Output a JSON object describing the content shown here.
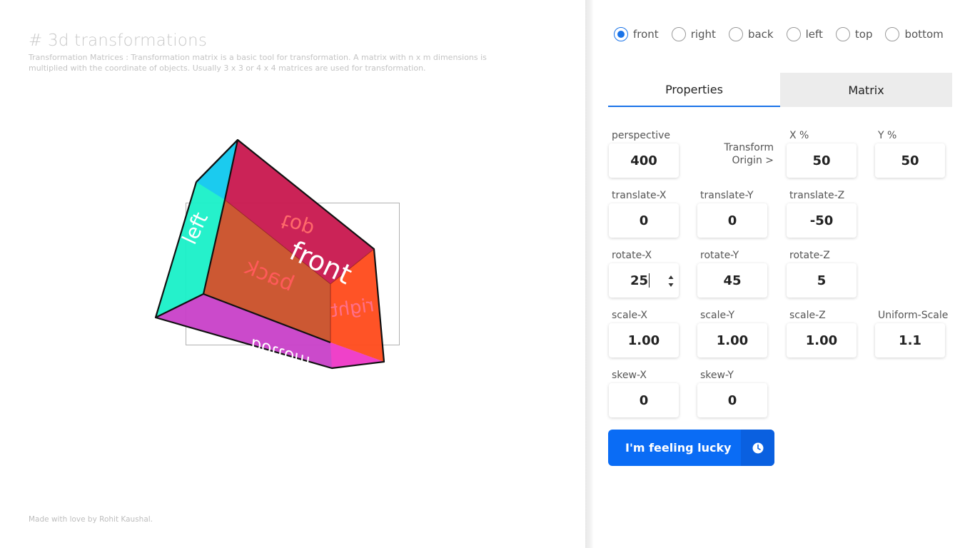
{
  "page": {
    "title": "# 3d transformations",
    "description": "Transformation Matrices : Transformation matrix is a basic tool for transformation. A matrix with n x m dimensions is multiplied with the coordinate of objects. Usually 3 x 3 or 4 x 4 matrices are used for transformation.",
    "footer": "Made with love by Rohit Kaushal."
  },
  "cube": {
    "faces": {
      "front": "front",
      "back": "back",
      "left": "left",
      "right": "right",
      "top": "top",
      "bottom": "bottom"
    },
    "colors": {
      "top": "#c8174e",
      "back": "#c84a22",
      "left": "#19f0c8",
      "left_top": "#1ac8f0",
      "right": "#ff4a1a",
      "bottom": "#c840c8",
      "bottom_right": "#f040c8"
    }
  },
  "faceSelector": {
    "selected": "front",
    "options": [
      "front",
      "right",
      "back",
      "left",
      "top",
      "bottom"
    ]
  },
  "tabs": {
    "properties": "Properties",
    "matrix": "Matrix",
    "active": "Properties"
  },
  "fields": {
    "perspective": {
      "label": "perspective",
      "value": "400"
    },
    "transformOrigin": {
      "label1": "Transform",
      "label2": "Origin >"
    },
    "originX": {
      "label": "X %",
      "value": "50"
    },
    "originY": {
      "label": "Y %",
      "value": "50"
    },
    "translateX": {
      "label": "translate-X",
      "value": "0"
    },
    "translateY": {
      "label": "translate-Y",
      "value": "0"
    },
    "translateZ": {
      "label": "translate-Z",
      "value": "-50"
    },
    "rotateX": {
      "label": "rotate-X",
      "value": "25"
    },
    "rotateY": {
      "label": "rotate-Y",
      "value": "45"
    },
    "rotateZ": {
      "label": "rotate-Z",
      "value": "5"
    },
    "scaleX": {
      "label": "scale-X",
      "value": "1.00"
    },
    "scaleY": {
      "label": "scale-Y",
      "value": "1.00"
    },
    "scaleZ": {
      "label": "scale-Z",
      "value": "1.00"
    },
    "uniformScale": {
      "label": "Uniform-Scale",
      "value": "1.1"
    },
    "skewX": {
      "label": "skew-X",
      "value": "0"
    },
    "skewY": {
      "label": "skew-Y",
      "value": "0"
    }
  },
  "luckyButton": {
    "label": "I'm feeling lucky",
    "icon": "clock-icon"
  },
  "accent": "#1a73e8"
}
